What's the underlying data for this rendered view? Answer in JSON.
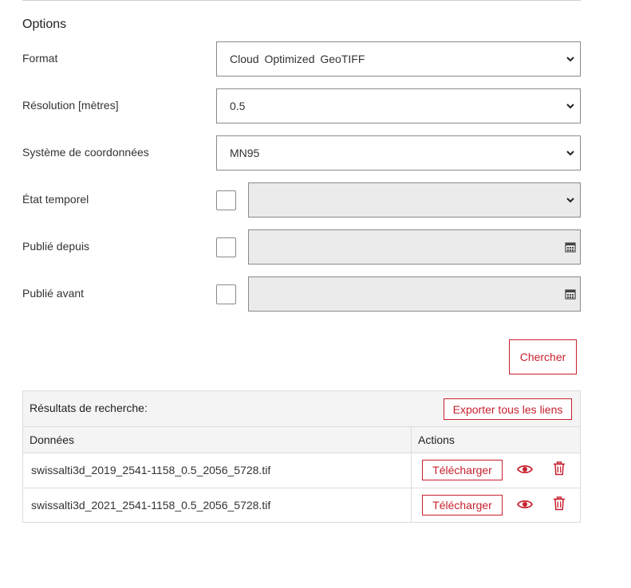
{
  "options": {
    "title": "Options",
    "format": {
      "label": "Format",
      "value": "Cloud Optimized GeoTIFF"
    },
    "resolution": {
      "label": "Résolution [mètres]",
      "value": "0.5"
    },
    "crs": {
      "label": "Système de coordonnées",
      "value": "MN95"
    },
    "temporal": {
      "label": "État temporel",
      "value": ""
    },
    "published_since": {
      "label": "Publié depuis"
    },
    "published_before": {
      "label": "Publié avant"
    },
    "search_button": "Chercher"
  },
  "results": {
    "title": "Résultats de recherche:",
    "export_button": "Exporter tous les liens",
    "columns": {
      "data": "Données",
      "actions": "Actions"
    },
    "rows": [
      {
        "file": "swissalti3d_2019_2541-1158_0.5_2056_5728.tif",
        "download": "Télécharger"
      },
      {
        "file": "swissalti3d_2021_2541-1158_0.5_2056_5728.tif",
        "download": "Télécharger"
      }
    ]
  },
  "colors": {
    "accent": "#c8202e",
    "disabled_bg": "#ebebeb",
    "header_bg": "#f4f4f4"
  },
  "icons": [
    "chevron-down-icon",
    "calendar-icon",
    "eye-icon",
    "trash-icon"
  ]
}
